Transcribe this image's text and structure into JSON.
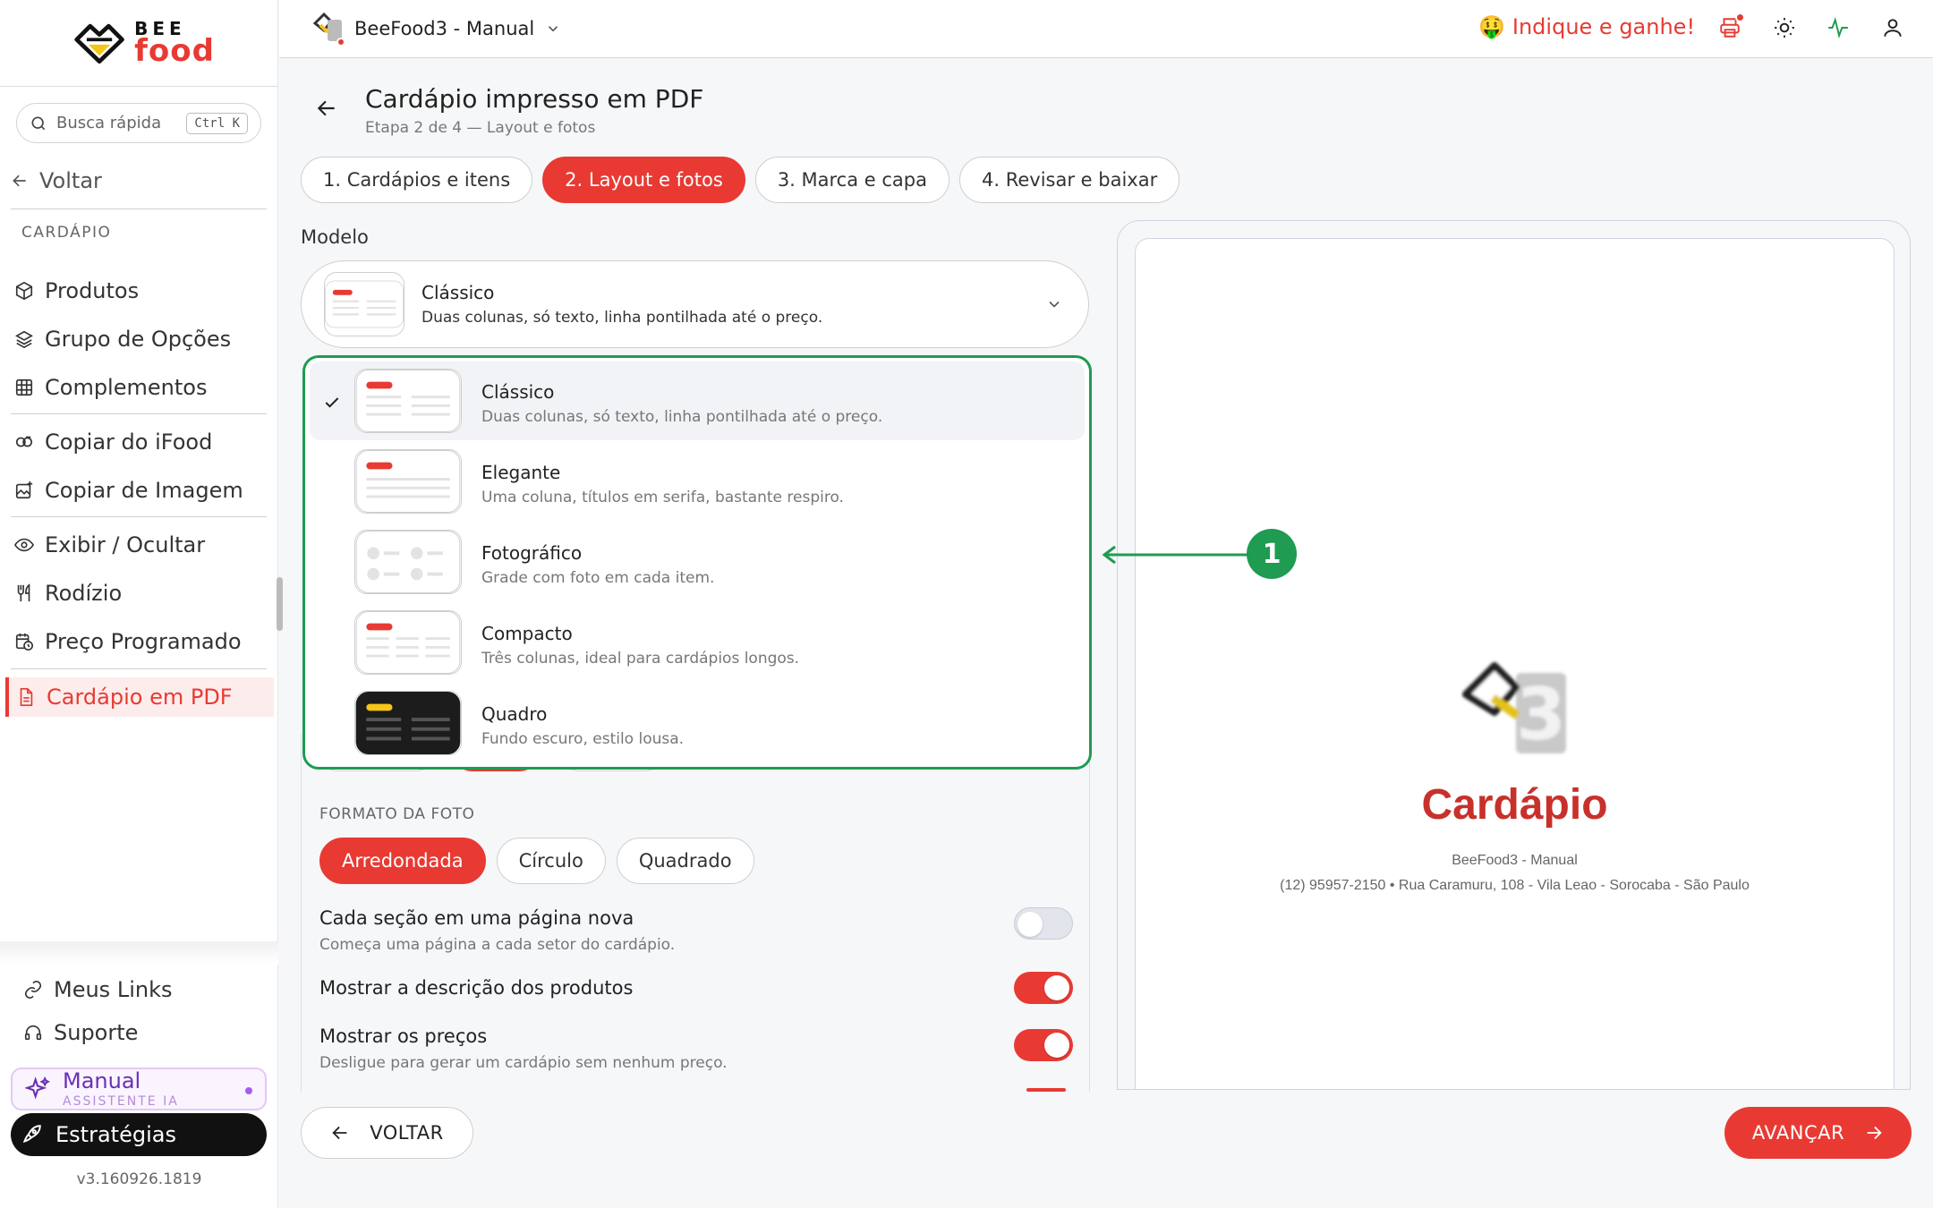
{
  "brand": {
    "line1": "BEE",
    "line2": "food"
  },
  "sidebar": {
    "search_placeholder": "Busca rápida",
    "search_shortcut": "Ctrl K",
    "back_label": "Voltar",
    "section": "CARDÁPIO",
    "items": [
      {
        "label": "Produtos",
        "icon": "box-icon"
      },
      {
        "label": "Grupo de Opções",
        "icon": "layers-icon"
      },
      {
        "label": "Complementos",
        "icon": "grid-icon"
      },
      {
        "label": "Copiar do iFood",
        "icon": "cloud-copy-icon"
      },
      {
        "label": "Copiar de Imagem",
        "icon": "image-plus-icon"
      },
      {
        "label": "Exibir / Ocultar",
        "icon": "eye-icon"
      },
      {
        "label": "Rodízio",
        "icon": "cutlery-icon"
      },
      {
        "label": "Preço Programado",
        "icon": "calendar-clock-icon"
      },
      {
        "label": "Cardápio em PDF",
        "icon": "document-icon"
      }
    ],
    "bottom": [
      {
        "label": "Meus Links",
        "icon": "link-icon"
      },
      {
        "label": "Suporte",
        "icon": "headset-icon"
      }
    ],
    "assistant": {
      "title": "Manual",
      "subtitle": "ASSISTENTE IA"
    },
    "strategies": "Estratégias",
    "version": "v3.160926.1819"
  },
  "topbar": {
    "store": "BeeFood3 - Manual",
    "refer": "Indique e ganhe!",
    "refer_emoji": "🤑"
  },
  "page": {
    "title": "Cardápio impresso em PDF",
    "subtitle": "Etapa 2 de 4 — Layout e fotos",
    "steps": [
      {
        "label": "1. Cardápios e itens",
        "active": false
      },
      {
        "label": "2. Layout e fotos",
        "active": true
      },
      {
        "label": "3. Marca e capa",
        "active": false
      },
      {
        "label": "4. Revisar e baixar",
        "active": false
      }
    ],
    "model_label": "Modelo",
    "model_selected": {
      "name": "Clássico",
      "desc": "Duas colunas, só texto, linha pontilhada até o preço."
    },
    "model_options": [
      {
        "name": "Clássico",
        "desc": "Duas colunas, só texto, linha pontilhada até o preço.",
        "selected": true
      },
      {
        "name": "Elegante",
        "desc": "Uma coluna, títulos em serifa, bastante respiro.",
        "selected": false
      },
      {
        "name": "Fotográfico",
        "desc": "Grade com foto em cada item.",
        "selected": false
      },
      {
        "name": "Compacto",
        "desc": "Três colunas, ideal para cardápios longos.",
        "selected": false
      },
      {
        "name": "Quadro",
        "desc": "Fundo escuro, estilo lousa.",
        "selected": false
      }
    ],
    "photo_format_label": "FORMATO DA FOTO",
    "photo_formats": [
      {
        "label": "Arredondada",
        "active": true
      },
      {
        "label": "Círculo",
        "active": false
      },
      {
        "label": "Quadrado",
        "active": false
      }
    ],
    "settings": [
      {
        "title": "Cada seção em uma página nova",
        "desc": "Começa uma página a cada setor do cardápio.",
        "on": false
      },
      {
        "title": "Mostrar a descrição dos produtos",
        "desc": "",
        "on": true
      },
      {
        "title": "Mostrar os preços",
        "desc": "Desligue para gerar um cardápio sem nenhum preço.",
        "on": true
      }
    ],
    "back_button": "VOLTAR",
    "next_button": "AVANÇAR"
  },
  "preview": {
    "title": "Cardápio",
    "store": "BeeFood3 - Manual",
    "contact": "(12) 95957-2150  •  Rua Caramuru, 108 - Vila Leao - Sorocaba - São Paulo"
  },
  "annotation": {
    "number": "1"
  },
  "colors": {
    "accent": "#e83a33",
    "annotation": "#1f9b52",
    "assistant": "#6a2fb5"
  }
}
